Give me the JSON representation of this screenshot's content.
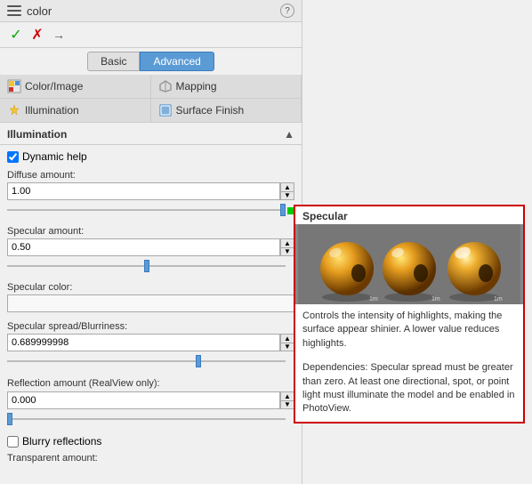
{
  "title": "color",
  "help_icon": "?",
  "toolbar": {
    "confirm_label": "✓",
    "cancel_label": "✗",
    "pin_label": "→"
  },
  "tabs": {
    "basic": "Basic",
    "advanced": "Advanced"
  },
  "nav": {
    "color_image": "Color/Image",
    "mapping": "Mapping",
    "illumination": "Illumination",
    "surface_finish": "Surface Finish"
  },
  "section": {
    "title": "Illumination",
    "dynamic_help_label": "Dynamic help"
  },
  "fields": {
    "diffuse_label": "Diffuse amount:",
    "diffuse_value": "1.00",
    "specular_label": "Specular amount:",
    "specular_value": "0.50",
    "specular_color_label": "Specular color:",
    "specular_spread_label": "Specular spread/Blurriness:",
    "specular_spread_value": "0.689999998",
    "reflection_label": "Reflection amount (RealView\nonly):",
    "reflection_value": "0.000",
    "blurry_label": "Blurry reflections",
    "transparent_label": "Transparent amount:"
  },
  "tooltip": {
    "title": "Specular",
    "text1": "Controls the intensity of highlights, making the surface appear shinier. A lower value reduces highlights.",
    "text2": "Dependencies: Specular spread must be greater than zero.  At least one directional, spot, or point light must illuminate the model and be enabled in PhotoView.",
    "balls_bg": "#888888"
  }
}
